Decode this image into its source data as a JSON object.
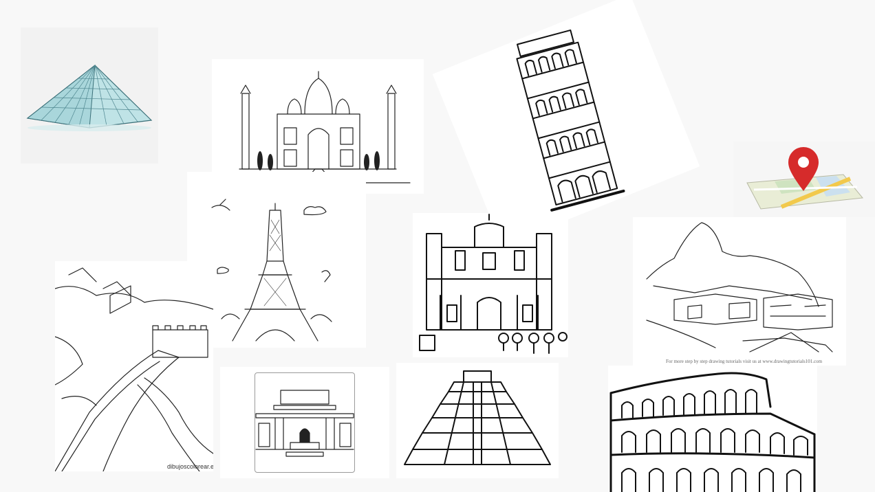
{
  "slide": {
    "background": "#f8f8f8",
    "images": [
      {
        "id": "louvre",
        "icon": "louvre-pyramid-icon"
      },
      {
        "id": "taj",
        "icon": "taj-mahal-icon"
      },
      {
        "id": "pisa",
        "icon": "leaning-tower-pisa-icon"
      },
      {
        "id": "map",
        "icon": "map-pin-icon",
        "pin_color": "#d62b2b"
      },
      {
        "id": "eiffel",
        "icon": "eiffel-tower-icon"
      },
      {
        "id": "petra",
        "icon": "petra-treasury-icon"
      },
      {
        "id": "machu",
        "icon": "machu-picchu-icon"
      },
      {
        "id": "wall",
        "icon": "great-wall-icon"
      },
      {
        "id": "prado",
        "icon": "prado-museum-icon"
      },
      {
        "id": "chichen",
        "icon": "chichen-itza-icon"
      },
      {
        "id": "colosseum",
        "icon": "colosseum-icon"
      }
    ]
  },
  "captions": {
    "great_wall_credit": "dibujoscolorear.es",
    "machu_credit": "For more step by step drawing tutorials visit us at www.drawingtutorials101.com"
  }
}
